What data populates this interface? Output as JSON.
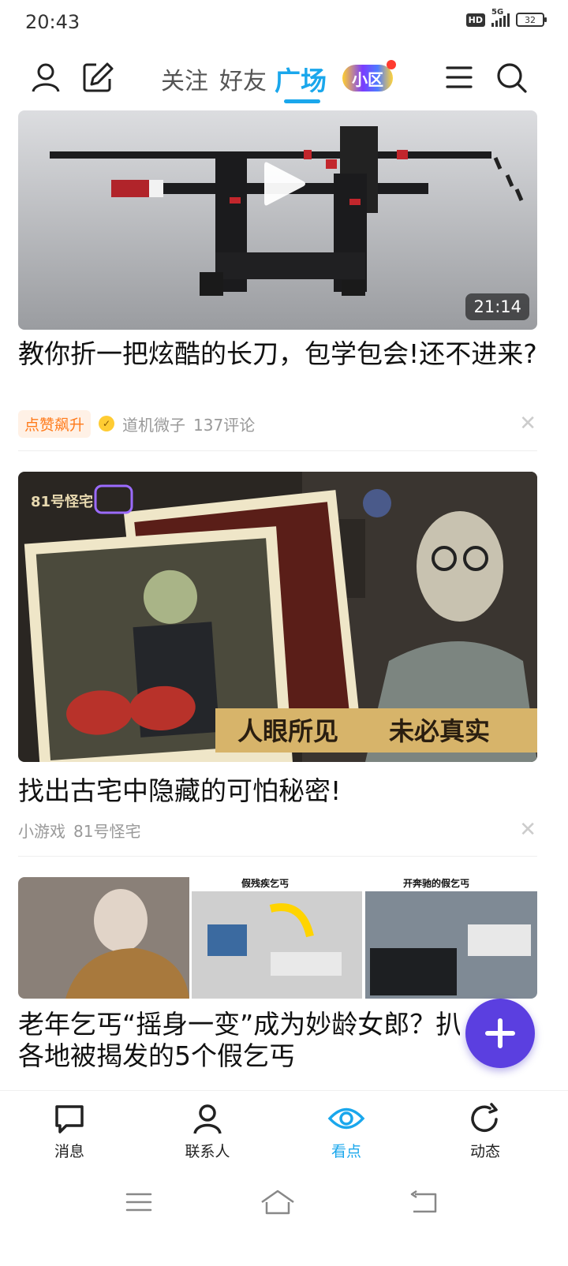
{
  "status_bar": {
    "time": "20:43",
    "hd": "HD",
    "network": "5G",
    "battery": "32"
  },
  "top_nav": {
    "tabs": [
      {
        "label": "关注"
      },
      {
        "label": "好友"
      },
      {
        "label": "广场",
        "active": true
      }
    ],
    "community_badge": "小区",
    "icons": [
      "profile-icon",
      "edit-icon",
      "menu-icon",
      "search-icon"
    ]
  },
  "feed": [
    {
      "type": "video",
      "title": "教你折一把炫酷的长刀，包学包会!还不进来?",
      "duration": "21:14",
      "tag": "点赞飙升",
      "author": "道机微子",
      "comments": "137评论"
    },
    {
      "type": "game",
      "title": "找出古宅中隐藏的可怕秘密!",
      "image_logo": "81号怪宅",
      "image_caption_left": "人眼所见",
      "image_caption_right": "未必真实",
      "category": "小游戏",
      "source": "81号怪宅"
    },
    {
      "type": "article",
      "title": "老年乞丐“摇身一变”成为妙龄女郎？扒",
      "title_line2": "各地被揭发的5个假乞丐",
      "image_label_1": "假残疾乞丐",
      "image_label_2": "开奔驰的假乞丐"
    }
  ],
  "bottom_nav": {
    "items": [
      {
        "label": "消息",
        "icon": "message-icon"
      },
      {
        "label": "联系人",
        "icon": "contacts-icon"
      },
      {
        "label": "看点",
        "icon": "eye-icon",
        "active": true
      },
      {
        "label": "动态",
        "icon": "refresh-icon"
      }
    ]
  },
  "colors": {
    "accent": "#1aa7ec",
    "fab": "#5b3fe0",
    "tag_text": "#ff7a1a",
    "tag_bg": "#fff1e6"
  }
}
